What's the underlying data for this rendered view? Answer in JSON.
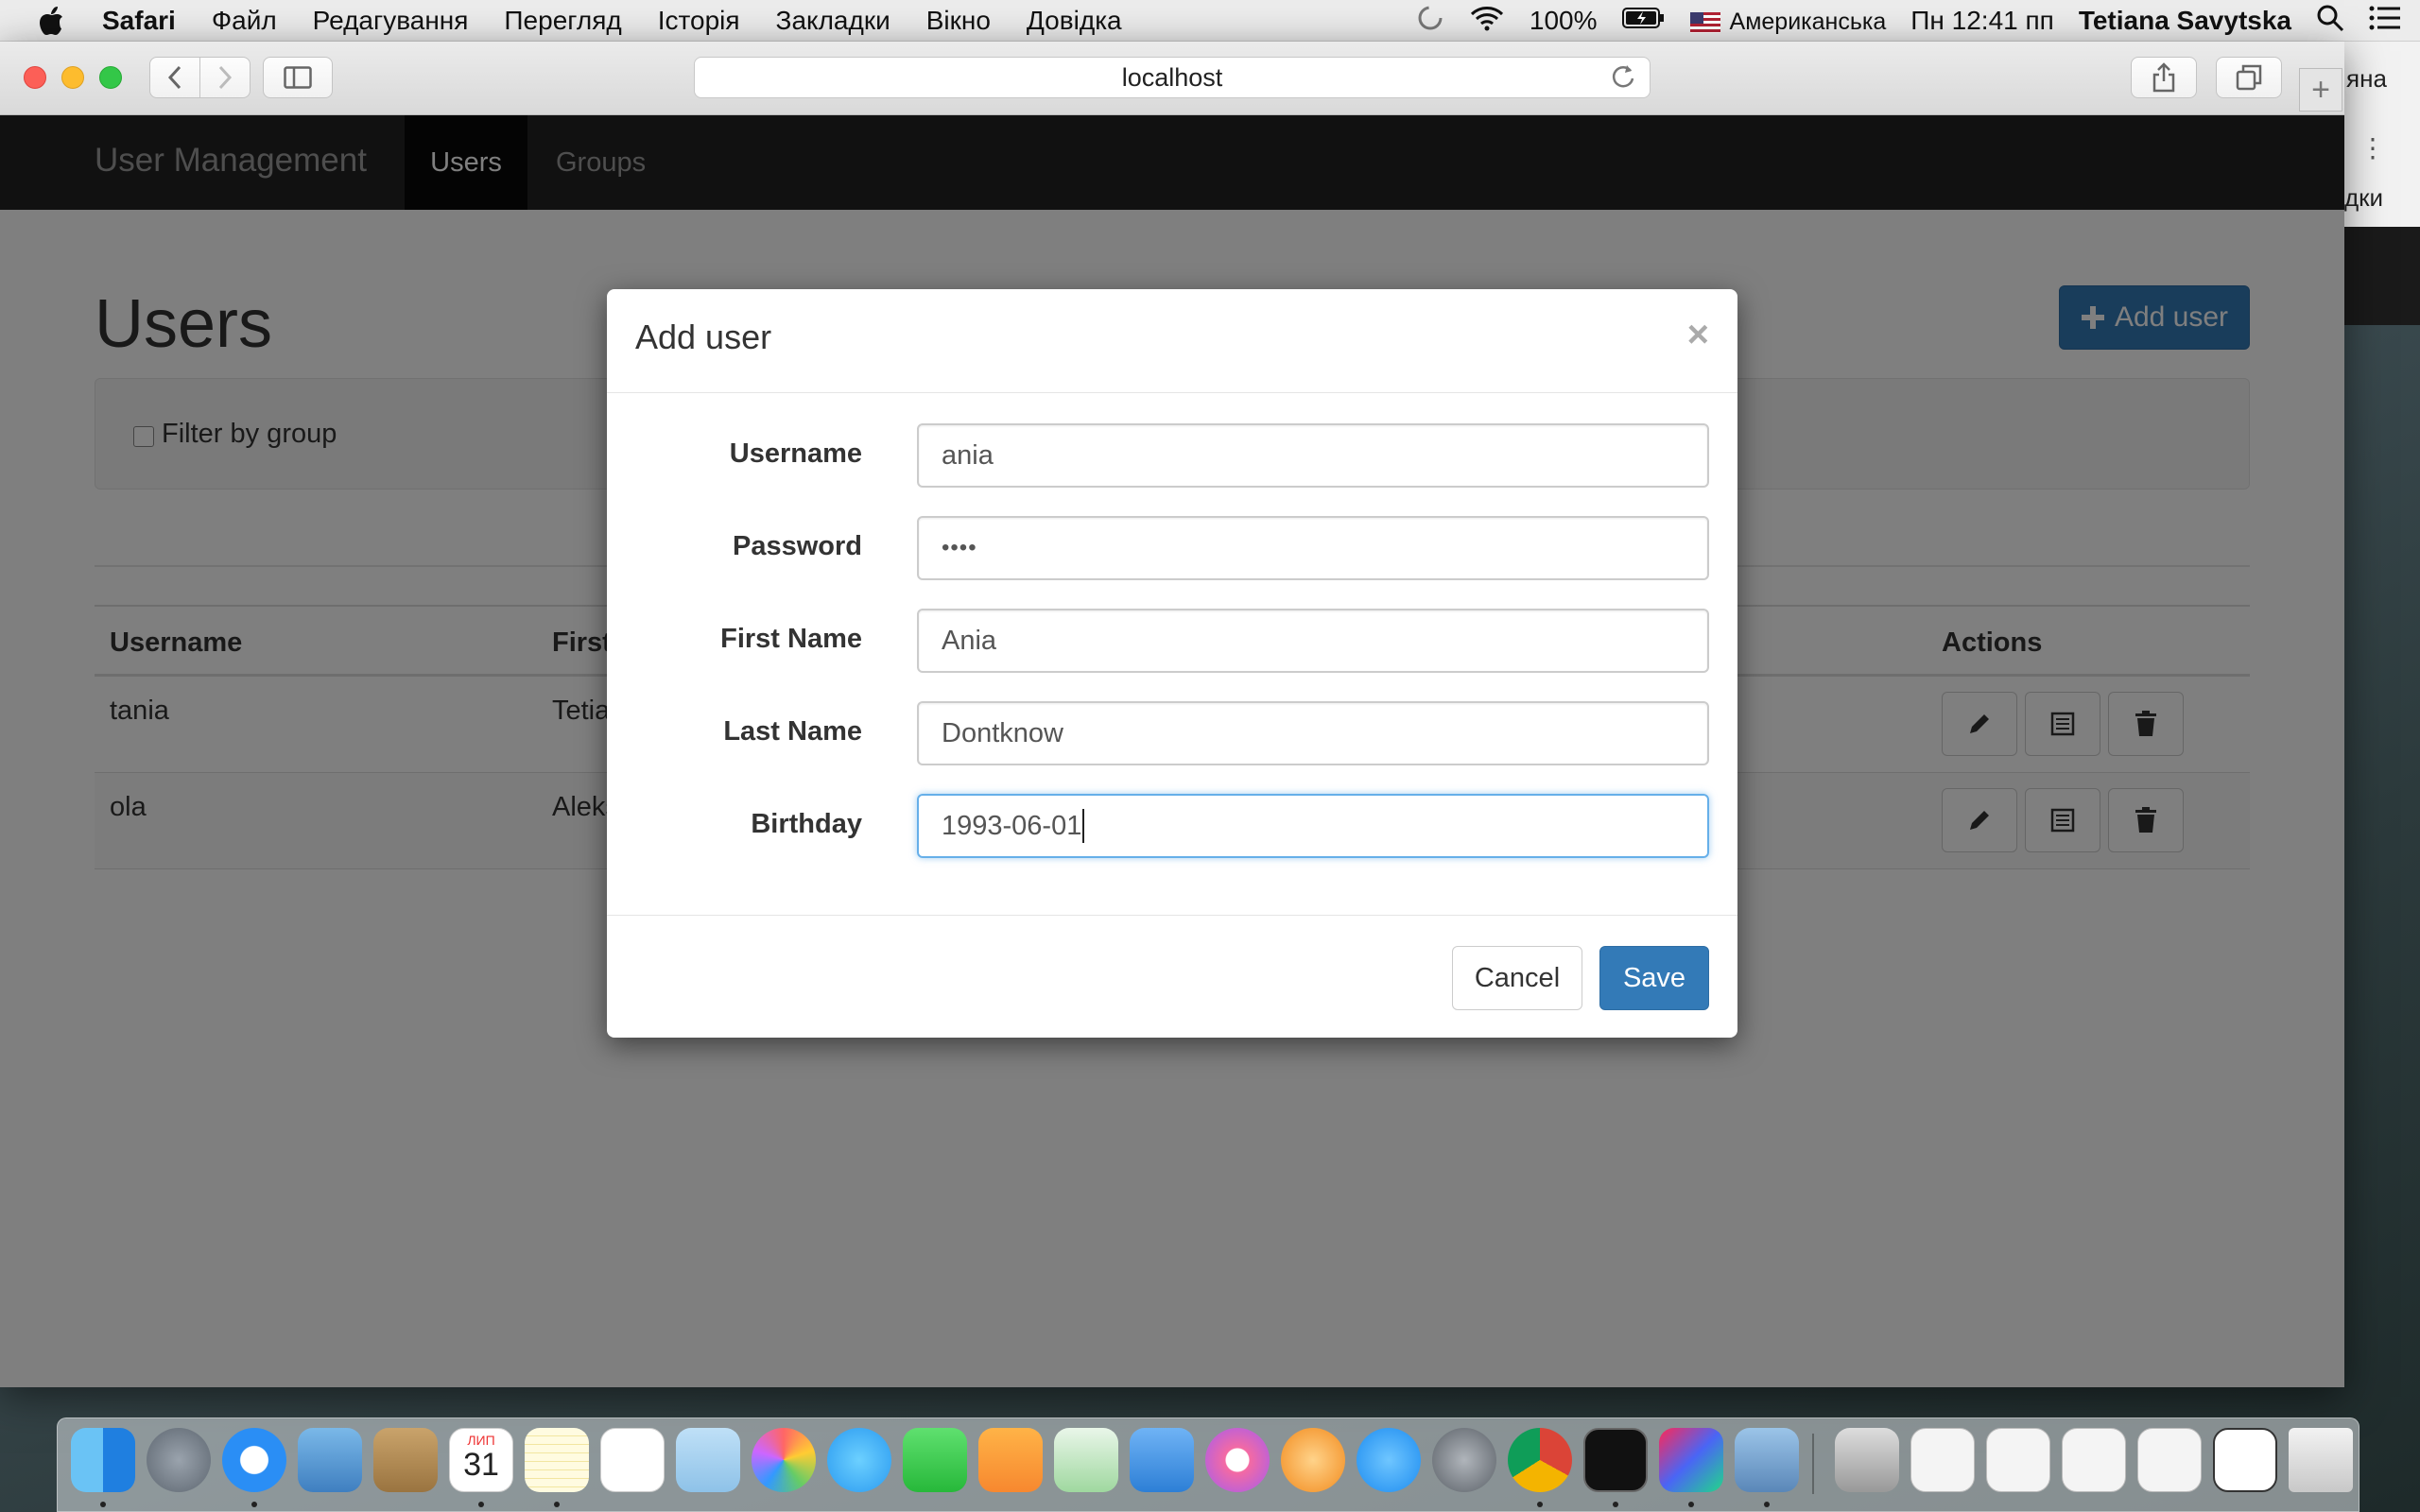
{
  "menubar": {
    "app_name": "Safari",
    "menus": [
      "Файл",
      "Редагування",
      "Перегляд",
      "Історія",
      "Закладки",
      "Вікно",
      "Довідка"
    ],
    "battery": "100%",
    "input_source": "Американська",
    "clock": "Пн 12:41 пп",
    "user": "Tetiana Savytska"
  },
  "browser": {
    "address": "localhost",
    "background_window_text": "яна",
    "background_window_text2": "дки"
  },
  "app": {
    "brand": "User Management",
    "nav_users": "Users",
    "nav_groups": "Groups",
    "page_title": "Users",
    "add_user_button": "Add user",
    "filter_label": "Filter by group",
    "table": {
      "columns": [
        "Username",
        "First",
        "Actions"
      ],
      "rows": [
        {
          "username": "tania",
          "first": "Tetia"
        },
        {
          "username": "ola",
          "first": "Aleks"
        }
      ]
    }
  },
  "modal": {
    "title": "Add user",
    "close": "×",
    "fields": {
      "username": {
        "label": "Username",
        "value": "ania"
      },
      "password": {
        "label": "Password",
        "value": "••••"
      },
      "first_name": {
        "label": "First Name",
        "value": "Ania"
      },
      "last_name": {
        "label": "Last Name",
        "value": "Dontknow"
      },
      "birthday": {
        "label": "Birthday",
        "value": "1993-06-01"
      }
    },
    "cancel_label": "Cancel",
    "save_label": "Save"
  },
  "dock": {
    "calendar_month": "ЛИП",
    "calendar_day": "31"
  },
  "colors": {
    "primary": "#337ab7",
    "navbar": "#222222",
    "focus": "#66afe9"
  }
}
